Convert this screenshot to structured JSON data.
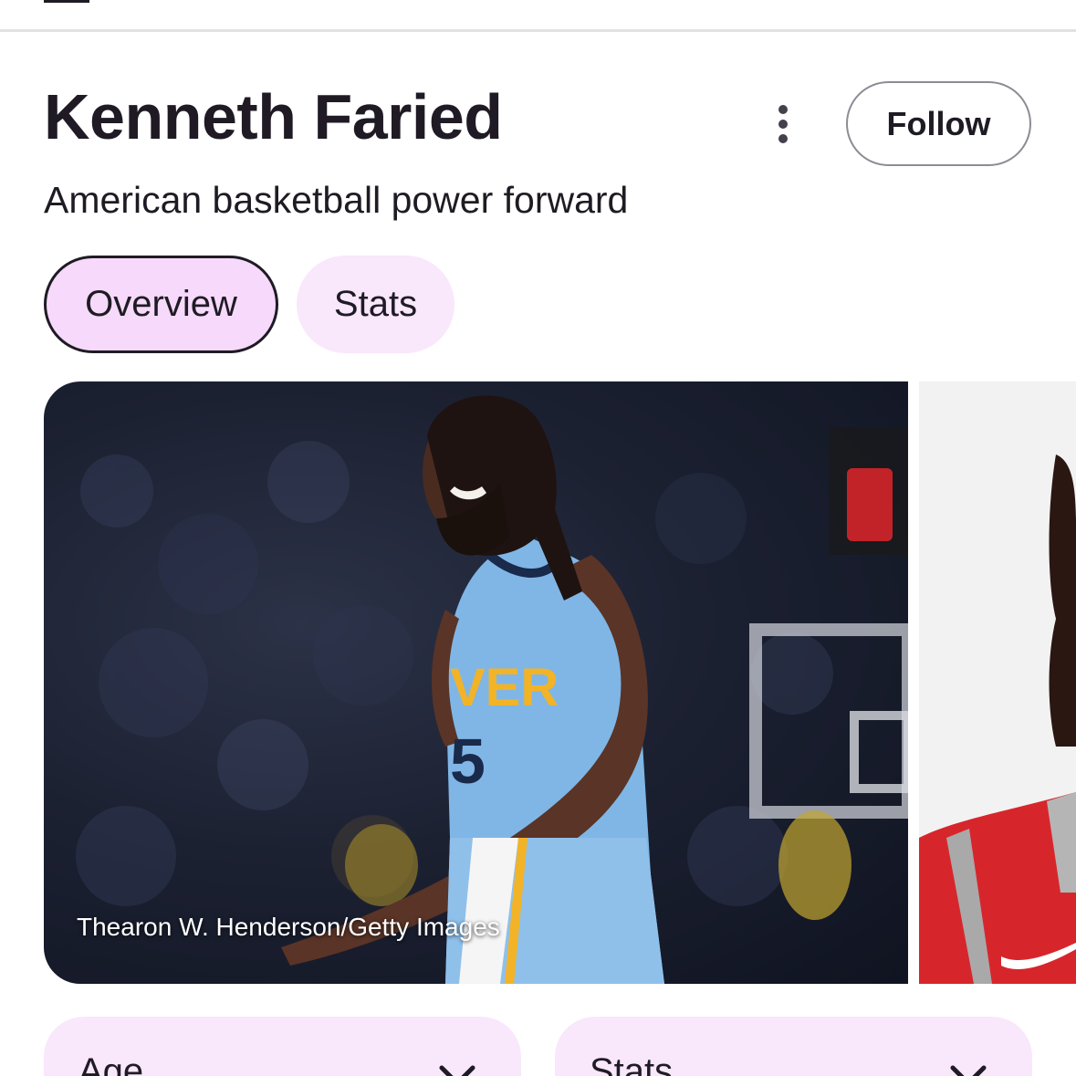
{
  "header": {
    "title": "Kenneth Faried",
    "subtitle": "American basketball power forward",
    "more_icon": "more-vert-icon",
    "follow_label": "Follow"
  },
  "tabs": [
    {
      "label": "Overview",
      "selected": true
    },
    {
      "label": "Stats",
      "selected": false
    }
  ],
  "images": [
    {
      "caption": "Thearon W. Henderson/Getty Images",
      "jersey_text": "VER",
      "jersey_number": "5"
    },
    {}
  ],
  "cards": [
    {
      "label": "Age",
      "icon": "chevron-down-icon"
    },
    {
      "label": "Stats",
      "icon": "chevron-down-icon"
    }
  ],
  "colors": {
    "chip_selected": "#f6d9fb",
    "chip_unselected": "#f9e7fb",
    "text": "#1f1b24",
    "jersey": "#7fb6e6",
    "jersey_trim": "#f2b327",
    "red_jersey": "#d7262b"
  }
}
